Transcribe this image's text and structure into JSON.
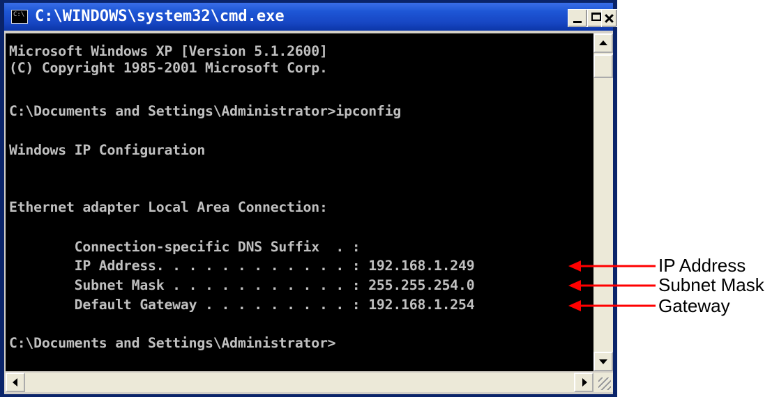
{
  "window": {
    "title": "C:\\WINDOWS\\system32\\cmd.exe",
    "icon_text": "C:\\"
  },
  "console": {
    "lines": [
      "Microsoft Windows XP [Version 5.1.2600]",
      "(C) Copyright 1985-2001 Microsoft Corp.",
      "",
      "C:\\Documents and Settings\\Administrator>ipconfig",
      "",
      "Windows IP Configuration",
      "",
      "",
      "Ethernet adapter Local Area Connection:",
      "",
      "        Connection-specific DNS Suffix  . :",
      "        IP Address. . . . . . . . . . . . : 192.168.1.249",
      "        Subnet Mask . . . . . . . . . . . : 255.255.254.0",
      "        Default Gateway . . . . . . . . . : 192.168.1.254",
      "",
      "C:\\Documents and Settings\\Administrator>"
    ]
  },
  "annotations": [
    {
      "label": "IP Address"
    },
    {
      "label": "Subnet Mask"
    },
    {
      "label": "Gateway"
    }
  ],
  "colors": {
    "console_bg": "#000000",
    "console_text": "#c0c0c0",
    "title_bar": "#1747c4",
    "arrow": "#ff0000"
  },
  "icons": {
    "window_icon": "cmd-icon",
    "minimize": "minimize-icon",
    "maximize": "maximize-icon",
    "close": "close-icon"
  }
}
